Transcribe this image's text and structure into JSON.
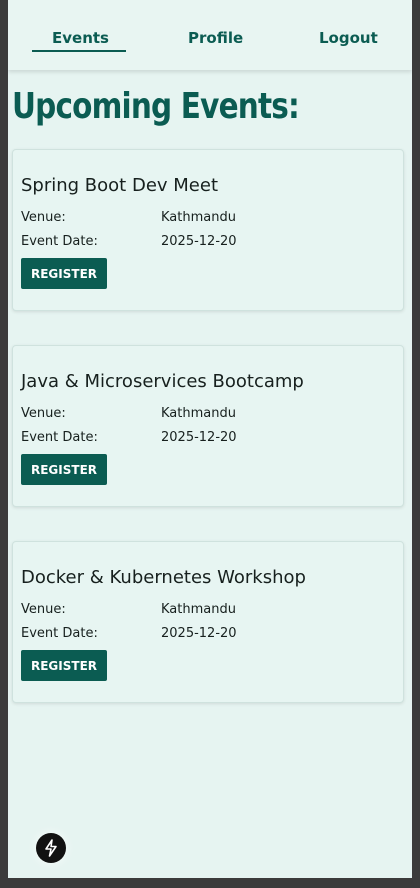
{
  "nav": {
    "items": [
      {
        "label": "Events"
      },
      {
        "label": "Profile"
      },
      {
        "label": "Logout"
      }
    ]
  },
  "page": {
    "title": "Upcoming Events:"
  },
  "events": [
    {
      "title": "Spring Boot Dev Meet",
      "venue_label": "Venue:",
      "venue": "Kathmandu",
      "date_label": "Event Date:",
      "date": "2025-12-20",
      "register_label": "REGISTER"
    },
    {
      "title": "Java & Microservices Bootcamp",
      "venue_label": "Venue:",
      "venue": "Kathmandu",
      "date_label": "Event Date:",
      "date": "2025-12-20",
      "register_label": "REGISTER"
    },
    {
      "title": "Docker & Kubernetes Workshop",
      "venue_label": "Venue:",
      "venue": "Kathmandu",
      "date_label": "Event Date:",
      "date": "2025-12-20",
      "register_label": "REGISTER"
    }
  ],
  "devtools_icon": "lightning-bolt-icon",
  "colors": {
    "accent": "#0b5c52",
    "background": "#e6f4f1",
    "text": "#17201e"
  }
}
